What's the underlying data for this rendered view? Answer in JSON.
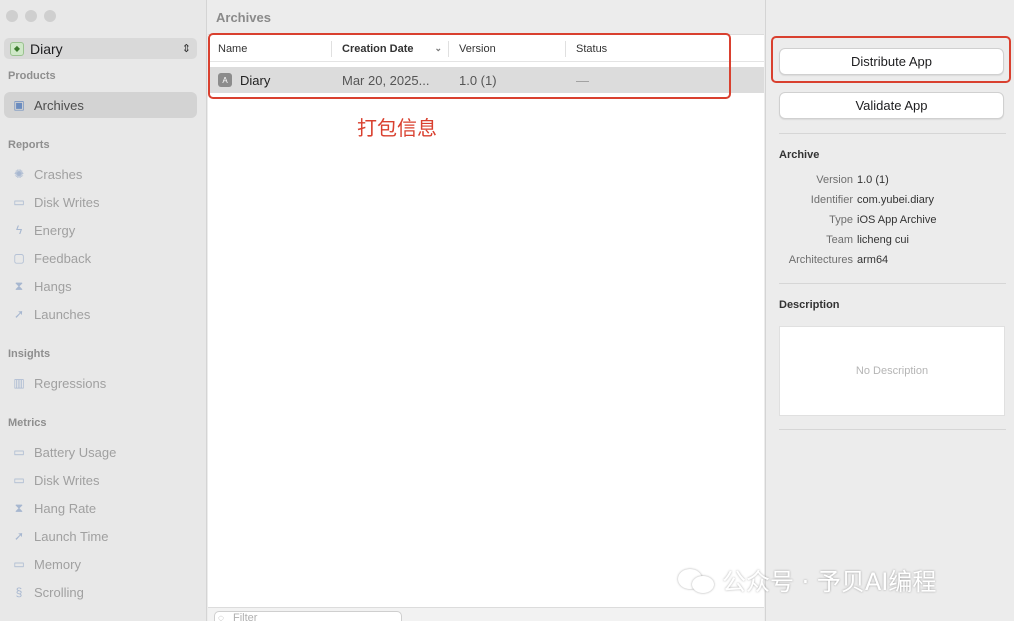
{
  "sidebar": {
    "scheme": {
      "label": "Diary"
    },
    "sections": {
      "products": "Products",
      "reports": "Reports",
      "insights": "Insights",
      "metrics": "Metrics"
    },
    "products_items": [
      {
        "label": "Archives",
        "icon": "archive-icon"
      }
    ],
    "reports_items": [
      {
        "label": "Crashes",
        "icon": "crash-icon"
      },
      {
        "label": "Disk Writes",
        "icon": "disk-icon"
      },
      {
        "label": "Energy",
        "icon": "energy-icon"
      },
      {
        "label": "Feedback",
        "icon": "feedback-icon"
      },
      {
        "label": "Hangs",
        "icon": "hourglass-icon"
      },
      {
        "label": "Launches",
        "icon": "rocket-icon"
      }
    ],
    "insights_items": [
      {
        "label": "Regressions",
        "icon": "chart-icon"
      }
    ],
    "metrics_items": [
      {
        "label": "Battery Usage",
        "icon": "battery-icon"
      },
      {
        "label": "Disk Writes",
        "icon": "disk-icon"
      },
      {
        "label": "Hang Rate",
        "icon": "hourglass-icon"
      },
      {
        "label": "Launch Time",
        "icon": "rocket-icon"
      },
      {
        "label": "Memory",
        "icon": "memory-icon"
      },
      {
        "label": "Scrolling",
        "icon": "scroll-icon"
      }
    ]
  },
  "middle": {
    "title": "Archives",
    "columns": [
      "Name",
      "Creation Date",
      "Version",
      "Status"
    ],
    "rows": [
      {
        "name": "Diary",
        "date": "Mar 20, 2025...",
        "version": "1.0 (1)",
        "status": "—"
      }
    ],
    "annotation": "打包信息",
    "filter_placeholder": "Filter"
  },
  "inspector": {
    "distribute_label": "Distribute App",
    "validate_label": "Validate App",
    "archive_heading": "Archive",
    "details": [
      {
        "key": "Version",
        "value": "1.0 (1)"
      },
      {
        "key": "Identifier",
        "value": "com.yubei.diary"
      },
      {
        "key": "Type",
        "value": "iOS App Archive"
      },
      {
        "key": "Team",
        "value": "licheng cui"
      },
      {
        "key": "Architectures",
        "value": "arm64"
      }
    ],
    "description_heading": "Description",
    "description_placeholder": "No Description"
  },
  "watermark": {
    "text": "公众号 · 予贝AI编程"
  },
  "colors": {
    "highlight": "#d9402f",
    "sidebar_bg": "#e8e8e8",
    "selected_row": "#dcdcdc"
  }
}
